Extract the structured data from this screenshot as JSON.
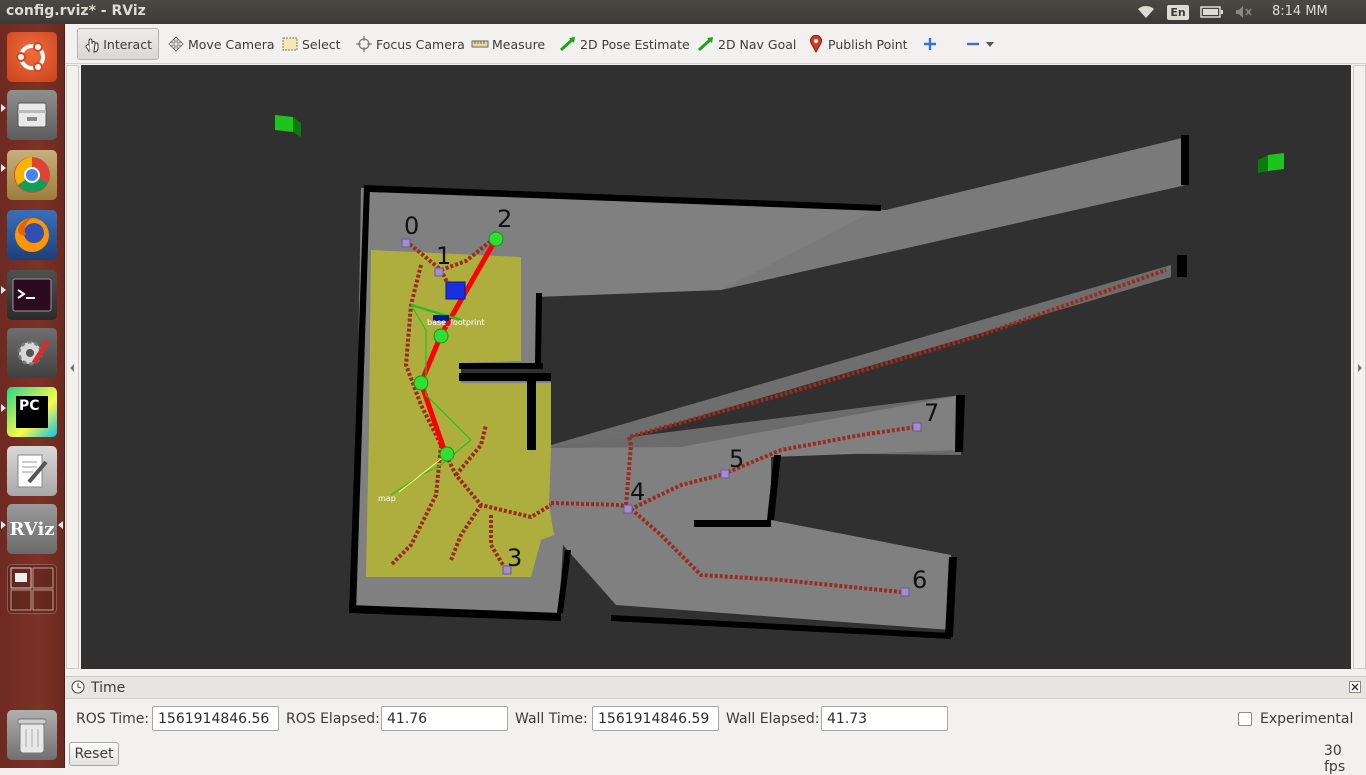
{
  "window": {
    "title": "config.rviz* - RViz"
  },
  "tray": {
    "lang": "En",
    "clock": "8:14 MM"
  },
  "launcher": {
    "items": [
      "ubuntu-dash",
      "files",
      "chrome",
      "firefox",
      "terminal",
      "system-settings",
      "pycharm",
      "text-editor",
      "rviz",
      "workspace-switcher",
      "trash"
    ],
    "rviz_label": "RViz",
    "pycharm_label": "PC"
  },
  "toolbar": {
    "interact": "Interact",
    "move_camera": "Move Camera",
    "select": "Select",
    "focus_camera": "Focus Camera",
    "measure": "Measure",
    "pose_estimate": "2D Pose Estimate",
    "nav_goal": "2D Nav Goal",
    "publish_point": "Publish Point"
  },
  "map": {
    "waypoints": [
      "0",
      "1",
      "2",
      "3",
      "4",
      "5",
      "6",
      "7"
    ],
    "robot_frame": "base_footprint",
    "map_frame": "map",
    "colors": {
      "background": "#303030",
      "free": "#808080",
      "wall": "#000000",
      "costmap": "#b0b03a",
      "path": "#ff0000",
      "graph": "#9b2a20",
      "marker": "#00ff00"
    }
  },
  "time_panel": {
    "title": "Time",
    "ros_time_label": "ROS Time:",
    "ros_time": "1561914846.56",
    "ros_elapsed_label": "ROS Elapsed:",
    "ros_elapsed": "41.76",
    "wall_time_label": "Wall Time:",
    "wall_time": "1561914846.59",
    "wall_elapsed_label": "Wall Elapsed:",
    "wall_elapsed": "41.73",
    "experimental_label": "Experimental",
    "reset_label": "Reset",
    "fps": "30 fps"
  }
}
